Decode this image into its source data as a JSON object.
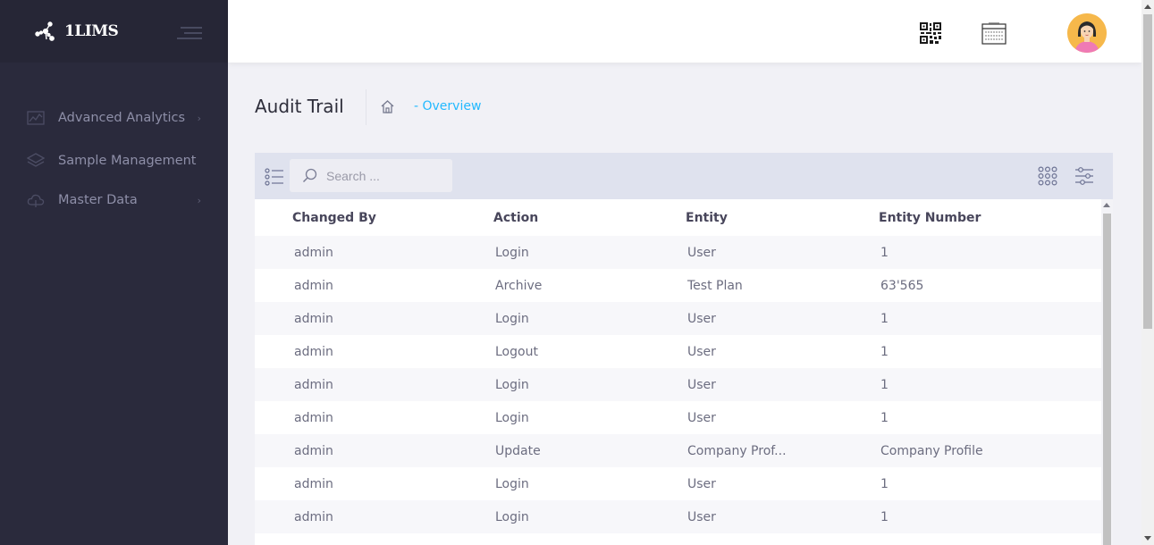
{
  "brand": {
    "name": "1LIMS",
    "logo_icon": "molecule-logo-icon"
  },
  "sidebar": {
    "toggle_icon": "hamburger-menu-icon",
    "items": [
      {
        "label": "Advanced Analytics",
        "icon": "chart-icon",
        "has_children": true
      },
      {
        "label": "Sample Management",
        "icon": "layers-icon",
        "has_children": false
      },
      {
        "label": "Master Data",
        "icon": "cloud-icon",
        "has_children": true
      }
    ]
  },
  "header": {
    "qr_icon": "qr-code-icon",
    "calendar_icon": "calendar-icon",
    "avatar_icon": "user-avatar",
    "avatar_color": "#f6b84b"
  },
  "subheader": {
    "title": "Audit Trail",
    "breadcrumb": {
      "home_icon": "home-icon",
      "current": "- Overview"
    }
  },
  "toolbar": {
    "search_placeholder": "Search ...",
    "list_icon": "list-icon",
    "grid_icon": "grid-icon",
    "filter_icon": "filter-sliders-icon"
  },
  "table": {
    "columns": [
      "Changed By",
      "Action",
      "Entity",
      "Entity Number"
    ],
    "rows": [
      [
        "admin",
        "Login",
        "User",
        "1"
      ],
      [
        "admin",
        "Archive",
        "Test Plan",
        "63'565"
      ],
      [
        "admin",
        "Login",
        "User",
        "1"
      ],
      [
        "admin",
        "Logout",
        "User",
        "1"
      ],
      [
        "admin",
        "Login",
        "User",
        "1"
      ],
      [
        "admin",
        "Login",
        "User",
        "1"
      ],
      [
        "admin",
        "Update",
        "Company Prof...",
        "Company Profile"
      ],
      [
        "admin",
        "Login",
        "User",
        "1"
      ],
      [
        "admin",
        "Login",
        "User",
        "1"
      ],
      [
        "",
        "",
        "",
        ""
      ]
    ]
  },
  "colors": {
    "sidebar_bg": "#2a2a3c",
    "accent": "#22b9ff",
    "toolbar_bg": "#dfe2ee",
    "page_bg": "#f1f1f6"
  }
}
